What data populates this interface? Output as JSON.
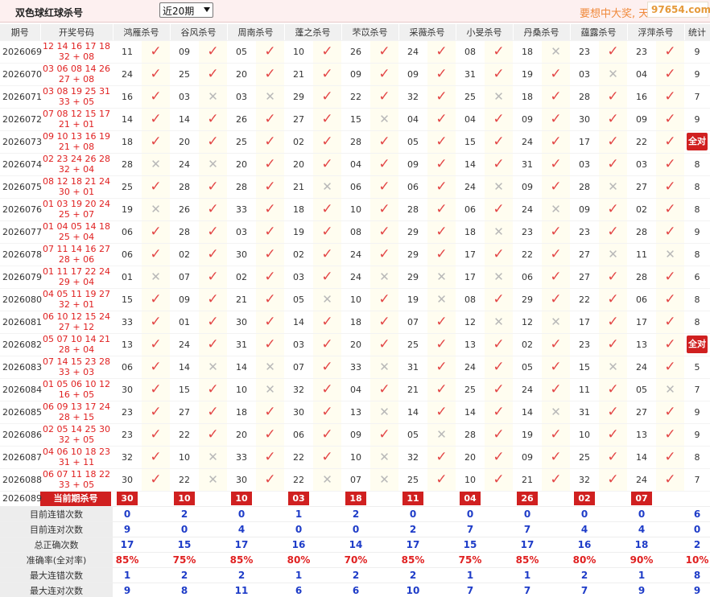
{
  "header": {
    "title": "双色球红球杀号",
    "select_value": "近20期",
    "marquee": "要想中大奖, 天",
    "watermark": "97654.com"
  },
  "columns": {
    "issue": "期号",
    "draw": "开奖号码",
    "stat": "统计",
    "experts": [
      "鸿雁杀号",
      "谷风杀号",
      "周南杀号",
      "蓬之杀号",
      "芣苡杀号",
      "采薇杀号",
      "小旻杀号",
      "丹桑杀号",
      "蕴露杀号",
      "浮萍杀号"
    ]
  },
  "rows": [
    {
      "issue": "2026069",
      "red": "12 14 16 17 18 32",
      "blue": "08",
      "picks": [
        "11",
        "09",
        "05",
        "10",
        "26",
        "24",
        "08",
        "18",
        "23",
        "23"
      ],
      "hits": [
        1,
        1,
        1,
        1,
        1,
        1,
        1,
        0,
        1,
        1
      ],
      "stat": "9"
    },
    {
      "issue": "2026070",
      "red": "03 06 08 14 26 27",
      "blue": "08",
      "picks": [
        "24",
        "25",
        "20",
        "21",
        "09",
        "09",
        "31",
        "19",
        "03",
        "04"
      ],
      "hits": [
        1,
        1,
        1,
        1,
        1,
        1,
        1,
        1,
        0,
        1
      ],
      "stat": "9"
    },
    {
      "issue": "2026071",
      "red": "03 08 19 25 31 33",
      "blue": "05",
      "picks": [
        "16",
        "03",
        "03",
        "29",
        "22",
        "32",
        "25",
        "18",
        "28",
        "16"
      ],
      "hits": [
        1,
        0,
        0,
        1,
        1,
        1,
        0,
        1,
        1,
        1
      ],
      "stat": "7"
    },
    {
      "issue": "2026072",
      "red": "07 08 12 15 17 21",
      "blue": "01",
      "picks": [
        "14",
        "14",
        "26",
        "27",
        "15",
        "04",
        "04",
        "09",
        "30",
        "09"
      ],
      "hits": [
        1,
        1,
        1,
        1,
        0,
        1,
        1,
        1,
        1,
        1
      ],
      "stat": "9"
    },
    {
      "issue": "2026073",
      "red": "09 10 13 16 19 21",
      "blue": "08",
      "picks": [
        "18",
        "20",
        "25",
        "02",
        "28",
        "05",
        "15",
        "24",
        "17",
        "22"
      ],
      "hits": [
        1,
        1,
        1,
        1,
        1,
        1,
        1,
        1,
        1,
        1
      ],
      "stat": "全对"
    },
    {
      "issue": "2026074",
      "red": "02 23 24 26 28 32",
      "blue": "04",
      "picks": [
        "28",
        "24",
        "20",
        "20",
        "04",
        "09",
        "14",
        "31",
        "03",
        "03"
      ],
      "hits": [
        0,
        0,
        1,
        1,
        1,
        1,
        1,
        1,
        1,
        1
      ],
      "stat": "8"
    },
    {
      "issue": "2026075",
      "red": "08 12 18 21 24 30",
      "blue": "01",
      "picks": [
        "25",
        "28",
        "28",
        "21",
        "06",
        "06",
        "24",
        "09",
        "28",
        "27"
      ],
      "hits": [
        1,
        1,
        1,
        0,
        1,
        1,
        0,
        1,
        0,
        1
      ],
      "stat": "8"
    },
    {
      "issue": "2026076",
      "red": "01 03 19 20 24 25",
      "blue": "07",
      "picks": [
        "19",
        "26",
        "33",
        "18",
        "10",
        "28",
        "06",
        "24",
        "09",
        "02"
      ],
      "hits": [
        0,
        1,
        1,
        1,
        1,
        1,
        1,
        0,
        1,
        1
      ],
      "stat": "8"
    },
    {
      "issue": "2026077",
      "red": "01 04 05 14 18 25",
      "blue": "04",
      "picks": [
        "06",
        "28",
        "03",
        "19",
        "08",
        "29",
        "18",
        "23",
        "23",
        "28"
      ],
      "hits": [
        1,
        1,
        1,
        1,
        1,
        1,
        0,
        1,
        1,
        1
      ],
      "stat": "9"
    },
    {
      "issue": "2026078",
      "red": "07 11 14 16 27 28",
      "blue": "06",
      "picks": [
        "06",
        "02",
        "30",
        "02",
        "24",
        "29",
        "17",
        "22",
        "27",
        "11"
      ],
      "hits": [
        1,
        1,
        1,
        1,
        1,
        1,
        1,
        1,
        0,
        0
      ],
      "stat": "8"
    },
    {
      "issue": "2026079",
      "red": "01 11 17 22 24 29",
      "blue": "04",
      "picks": [
        "01",
        "07",
        "02",
        "03",
        "24",
        "29",
        "17",
        "06",
        "27",
        "28"
      ],
      "hits": [
        0,
        1,
        1,
        1,
        0,
        0,
        0,
        1,
        1,
        1
      ],
      "stat": "6"
    },
    {
      "issue": "2026080",
      "red": "04 05 11 19 27 32",
      "blue": "01",
      "picks": [
        "15",
        "09",
        "21",
        "05",
        "10",
        "19",
        "08",
        "29",
        "22",
        "06"
      ],
      "hits": [
        1,
        1,
        1,
        0,
        1,
        0,
        1,
        1,
        1,
        1
      ],
      "stat": "8"
    },
    {
      "issue": "2026081",
      "red": "06 10 12 15 24 27",
      "blue": "12",
      "picks": [
        "33",
        "01",
        "30",
        "14",
        "18",
        "07",
        "12",
        "12",
        "17",
        "17"
      ],
      "hits": [
        1,
        1,
        1,
        1,
        1,
        1,
        0,
        0,
        1,
        1
      ],
      "stat": "8"
    },
    {
      "issue": "2026082",
      "red": "05 07 10 14 21 28",
      "blue": "04",
      "picks": [
        "13",
        "24",
        "31",
        "03",
        "20",
        "25",
        "13",
        "02",
        "23",
        "13"
      ],
      "hits": [
        1,
        1,
        1,
        1,
        1,
        1,
        1,
        1,
        1,
        1
      ],
      "stat": "全对"
    },
    {
      "issue": "2026083",
      "red": "07 14 15 23 28 33",
      "blue": "03",
      "picks": [
        "06",
        "14",
        "14",
        "07",
        "33",
        "31",
        "24",
        "05",
        "15",
        "24"
      ],
      "hits": [
        1,
        0,
        0,
        1,
        0,
        1,
        1,
        1,
        0,
        1
      ],
      "stat": "5"
    },
    {
      "issue": "2026084",
      "red": "01 05 06 10 12 16",
      "blue": "05",
      "picks": [
        "30",
        "15",
        "10",
        "32",
        "04",
        "21",
        "25",
        "24",
        "11",
        "05"
      ],
      "hits": [
        1,
        1,
        0,
        1,
        1,
        1,
        1,
        1,
        1,
        0
      ],
      "stat": "7"
    },
    {
      "issue": "2026085",
      "red": "06 09 13 17 24 28",
      "blue": "15",
      "picks": [
        "23",
        "27",
        "18",
        "30",
        "13",
        "14",
        "14",
        "14",
        "31",
        "27"
      ],
      "hits": [
        1,
        1,
        1,
        1,
        0,
        1,
        1,
        0,
        1,
        1
      ],
      "stat": "9"
    },
    {
      "issue": "2026086",
      "red": "02 05 14 25 30 32",
      "blue": "05",
      "picks": [
        "23",
        "22",
        "20",
        "06",
        "09",
        "05",
        "28",
        "19",
        "10",
        "13"
      ],
      "hits": [
        1,
        1,
        1,
        1,
        1,
        0,
        1,
        1,
        1,
        1
      ],
      "stat": "9"
    },
    {
      "issue": "2026087",
      "red": "04 06 10 18 23 31",
      "blue": "11",
      "picks": [
        "32",
        "10",
        "33",
        "22",
        "10",
        "32",
        "20",
        "09",
        "25",
        "14"
      ],
      "hits": [
        1,
        0,
        1,
        1,
        0,
        1,
        1,
        1,
        1,
        1
      ],
      "stat": "8"
    },
    {
      "issue": "2026088",
      "red": "06 07 11 18 22 33",
      "blue": "05",
      "picks": [
        "30",
        "22",
        "30",
        "22",
        "07",
        "25",
        "10",
        "21",
        "32",
        "24"
      ],
      "hits": [
        1,
        0,
        1,
        0,
        0,
        1,
        1,
        1,
        1,
        1
      ],
      "stat": "7"
    }
  ],
  "current": {
    "issue": "2026089",
    "label": "当前期杀号",
    "picks": [
      "30",
      "10",
      "10",
      "03",
      "18",
      "11",
      "04",
      "26",
      "02",
      "07"
    ]
  },
  "summary": [
    {
      "label": "目前连错次数",
      "values": [
        "0",
        "2",
        "0",
        "1",
        "2",
        "0",
        "0",
        "0",
        "0",
        "0"
      ],
      "stat": "6"
    },
    {
      "label": "目前连对次数",
      "values": [
        "9",
        "0",
        "4",
        "0",
        "0",
        "2",
        "7",
        "7",
        "4",
        "4"
      ],
      "stat": "0"
    },
    {
      "label": "总正确次数",
      "values": [
        "17",
        "15",
        "17",
        "16",
        "14",
        "17",
        "15",
        "17",
        "16",
        "18"
      ],
      "stat": "2"
    },
    {
      "label": "准确率(全对率)",
      "values": [
        "85%",
        "75%",
        "85%",
        "80%",
        "70%",
        "85%",
        "75%",
        "85%",
        "80%",
        "90%"
      ],
      "stat": "10%"
    },
    {
      "label": "最大连错次数",
      "values": [
        "1",
        "2",
        "2",
        "1",
        "2",
        "2",
        "1",
        "1",
        "2",
        "1"
      ],
      "stat": "8"
    },
    {
      "label": "最大连对次数",
      "values": [
        "9",
        "8",
        "11",
        "6",
        "6",
        "10",
        "7",
        "7",
        "7",
        "9"
      ],
      "stat": "9"
    }
  ],
  "colors": {
    "accent_red": "#d02020",
    "tick_red": "#e34646",
    "summary_blue": "#1e3cc8",
    "header_gray": "#f0f0f0"
  }
}
